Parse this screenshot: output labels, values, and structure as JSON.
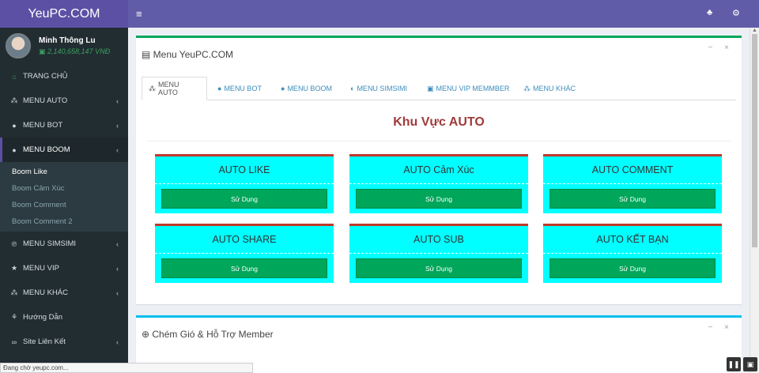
{
  "brand": "YeuPC.COM",
  "user": {
    "name": "Minh Thông Lu",
    "balance": "2,140,658,147 VNĐ"
  },
  "nav": [
    {
      "label": "TRANG CHỦ",
      "icon": "home-icon"
    },
    {
      "label": "MENU AUTO",
      "icon": "sitemap-icon"
    },
    {
      "label": "MENU BOT",
      "icon": "bot-icon"
    },
    {
      "label": "MENU BOOM",
      "icon": "bomb-icon"
    },
    {
      "label": "MENU SIMSIMI",
      "icon": "chat-icon"
    },
    {
      "label": "MENU VIP",
      "icon": "star-icon"
    },
    {
      "label": "MENU KHÁC",
      "icon": "sitemap-icon"
    },
    {
      "label": "Hướng Dẫn",
      "icon": "guide-icon"
    },
    {
      "label": "Site Liên Kết",
      "icon": "link-icon"
    }
  ],
  "submenu": [
    "Boom Like",
    "Boom Cảm Xúc",
    "Boom Comment",
    "Boom Comment 2"
  ],
  "main_box": {
    "title": "Menu YeuPC.COM",
    "tabs": [
      "MENU AUTO",
      "MENU BOT",
      "MENU BOOM",
      "MENU SIMSIMI",
      "MENU VIP MEMMBER",
      "MENU KHÁC"
    ],
    "section_title": "Khu Vực AUTO",
    "cards": [
      {
        "title": "AUTO LIKE",
        "button": "Sử Dụng"
      },
      {
        "title": "AUTO Cảm Xúc",
        "button": "Sử Dụng"
      },
      {
        "title": "AUTO COMMENT",
        "button": "Sử Dụng"
      },
      {
        "title": "AUTO SHARE",
        "button": "Sử Dụng"
      },
      {
        "title": "AUTO SUB",
        "button": "Sử Dụng"
      },
      {
        "title": "AUTO KẾT BẠN",
        "button": "Sử Dụng"
      }
    ]
  },
  "chat_box": {
    "title": "Chém Gió & Hỗ Trợ Member"
  },
  "status_text": "Đang chờ yeupc.com...",
  "box_tools": "− ×",
  "colors": {
    "header": "#605ca8",
    "sidebar": "#222d32",
    "card": "#00ffff",
    "button": "#00a65a",
    "section_title": "#a03a3a"
  }
}
